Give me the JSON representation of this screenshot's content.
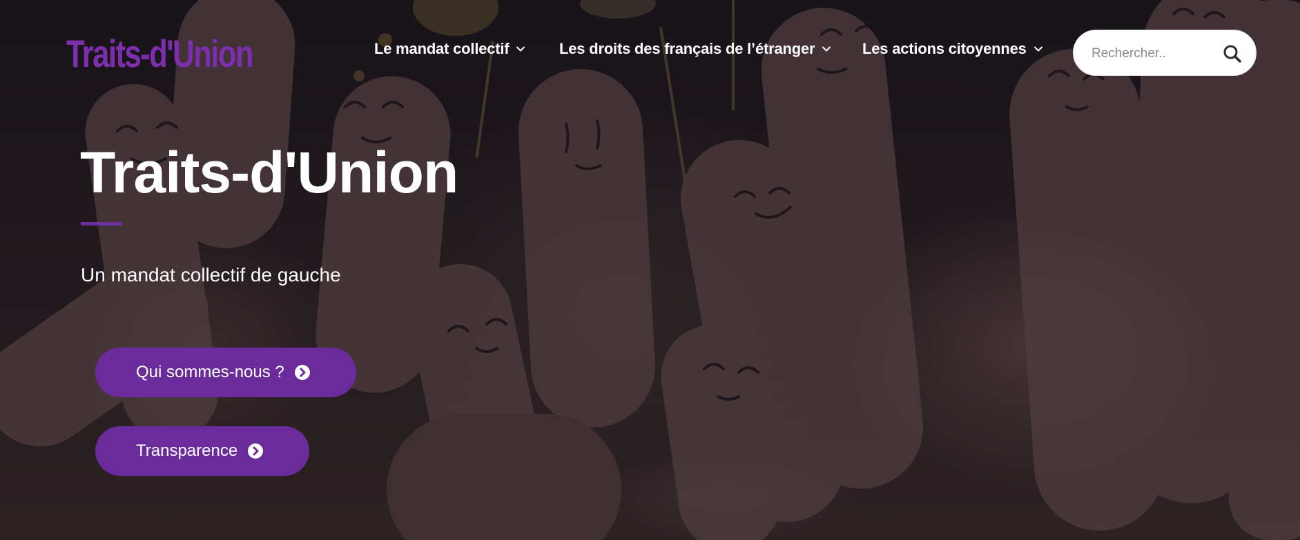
{
  "header": {
    "logo_text": "Traits-d'Union",
    "nav": [
      {
        "label": "Le mandat collectif",
        "icon": "chevron-down-icon"
      },
      {
        "label": "Les droits des français de l’étranger",
        "icon": "chevron-down-icon"
      },
      {
        "label": "Les actions citoyennes",
        "icon": "chevron-down-icon"
      }
    ],
    "search": {
      "placeholder": "Rechercher..",
      "icon": "search-icon"
    }
  },
  "hero": {
    "title": "Traits-d'Union",
    "subtitle": "Un mandat collectif de gauche",
    "buttons": [
      {
        "label": "Qui sommes-nous ?",
        "icon": "chevron-circle-right-icon"
      },
      {
        "label": "Transparence",
        "icon": "chevron-circle-right-icon"
      }
    ]
  },
  "colors": {
    "brand_purple": "#6a2c9a",
    "logo_purple": "#7b2fa8",
    "text_white": "#ffffff",
    "search_bg": "#ffffff"
  }
}
